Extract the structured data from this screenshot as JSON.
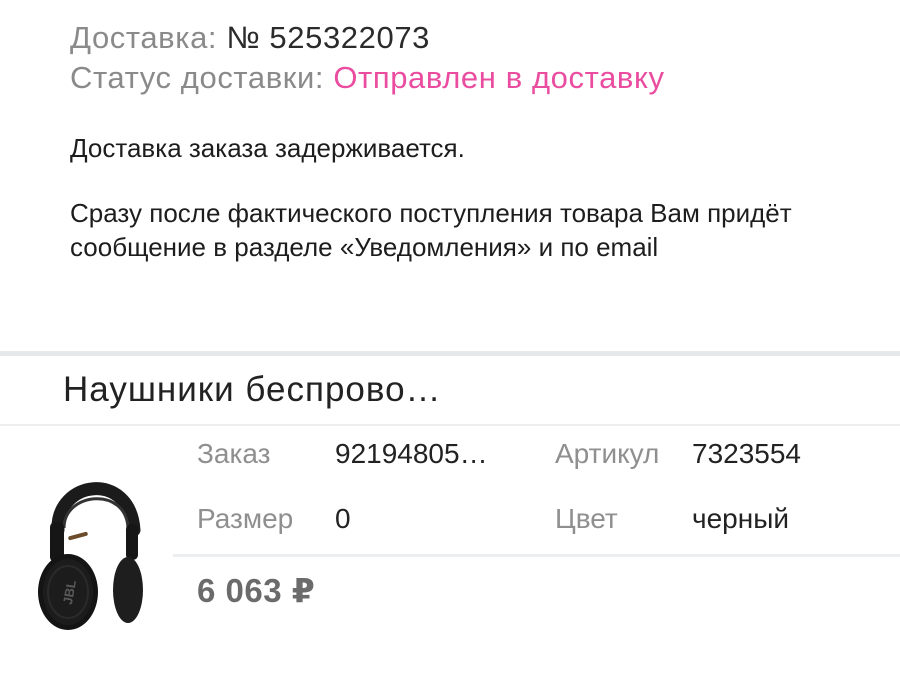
{
  "delivery": {
    "number_label": "Доставка:",
    "number_value": "№ 525322073",
    "status_label": "Статус доставки:",
    "status_value": "Отправлен в доставку",
    "message_delay": "Доставка заказа задерживается.",
    "message_notice": "Сразу после фактического поступления товара Вам придёт сообщение в разделе «Уведомления» и по email"
  },
  "product": {
    "title": "Наушники беспрово…",
    "image_label": "JBL headphones",
    "order_label": "Заказ",
    "order_value": "92194805…",
    "article_label": "Артикул",
    "article_value": "7323554",
    "size_label": "Размер",
    "size_value": "0",
    "color_label": "Цвет",
    "color_value": "черный",
    "price": "6 063 ₽"
  },
  "colors": {
    "status_accent": "#ea4d9f",
    "muted_text": "#8a8a8a",
    "separator": "#e6e8eb"
  }
}
